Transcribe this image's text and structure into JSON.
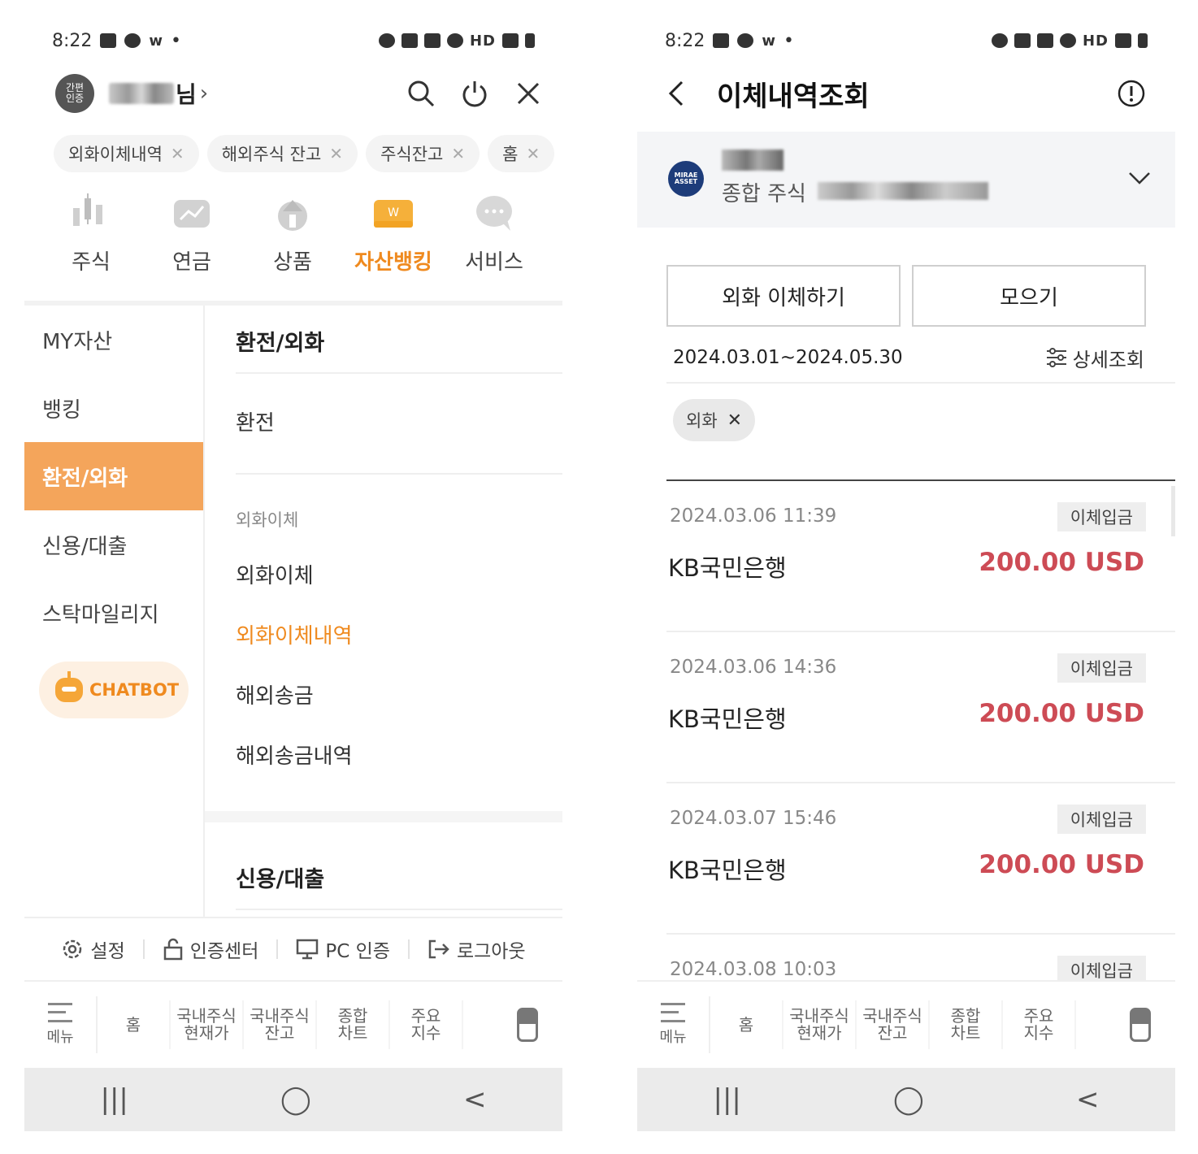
{
  "left": {
    "status": {
      "time": "8:22",
      "icons_left": [
        "gallery-icon",
        "talk-icon",
        "w-icon"
      ],
      "icons_right": [
        "alarm-icon",
        "mute-icon",
        "battery-saver-icon",
        "wifi-icon",
        "hd-voice-icon",
        "signal-icon",
        "battery-icon"
      ]
    },
    "header": {
      "avatar_text": "간편\n인증",
      "name_suffix": "님",
      "chevron": "›"
    },
    "recent_chips": [
      {
        "label": "외화이체내역"
      },
      {
        "label": "해외주식 잔고"
      },
      {
        "label": "주식잔고"
      },
      {
        "label": "홈"
      }
    ],
    "categories": [
      {
        "label": "주식",
        "icon": "stock-candle-icon"
      },
      {
        "label": "연금",
        "icon": "pension-icon"
      },
      {
        "label": "상품",
        "icon": "product-icon"
      },
      {
        "label": "자산뱅킹",
        "icon": "wallet-icon",
        "active": true
      },
      {
        "label": "서비스",
        "icon": "chat-bubble-icon"
      }
    ],
    "side_menu": [
      "MY자산",
      "뱅킹",
      "환전/외화",
      "신용/대출",
      "스탁마일리지"
    ],
    "side_active": "환전/외화",
    "chatbot_label": "CHATBOT",
    "main_menu": {
      "section1_title": "환전/외화",
      "item_exchange": "환전",
      "sub_title": "외화이체",
      "items": [
        "외화이체",
        "외화이체내역",
        "해외송금",
        "해외송금내역"
      ],
      "active_item": "외화이체내역",
      "section2_title": "신용/대출"
    },
    "util": [
      "설정",
      "인증센터",
      "PC 인증",
      "로그아웃"
    ],
    "tabbar": {
      "menu_label": "메뉴",
      "items": [
        "홈",
        "국내주식\n현재가",
        "국내주식\n잔고",
        "종합\n차트",
        "주요\n지수"
      ]
    },
    "navbar": [
      "|||",
      "◯",
      "<"
    ]
  },
  "right": {
    "status": {
      "time": "8:22"
    },
    "header": {
      "title": "이체내역조회"
    },
    "account": {
      "logo_text": "MIRAE\nASSET",
      "type": "종합 주식"
    },
    "buttons": [
      "외화 이체하기",
      "모으기"
    ],
    "date_range": "2024.03.01~2024.05.30",
    "detail_label": "상세조회",
    "filter_chip": "외화",
    "transactions": [
      {
        "date": "2024.03.06 11:39",
        "badge": "이체입금",
        "bank": "KB국민은행",
        "amount": "200.00 USD"
      },
      {
        "date": "2024.03.06 14:36",
        "badge": "이체입금",
        "bank": "KB국민은행",
        "amount": "200.00 USD"
      },
      {
        "date": "2024.03.07 15:46",
        "badge": "이체입금",
        "bank": "KB국민은행",
        "amount": "200.00 USD"
      },
      {
        "date": "2024.03.08 10:03",
        "badge": "이체입금",
        "bank": "",
        "amount": ""
      }
    ],
    "tabbar": {
      "menu_label": "메뉴",
      "items": [
        "홈",
        "국내주식\n현재가",
        "국내주식\n잔고",
        "종합\n차트",
        "주요\n지수"
      ]
    },
    "navbar": [
      "|||",
      "◯",
      "<"
    ]
  },
  "colors": {
    "accent": "#ef8a1f",
    "active_side_bg": "#f4a55b",
    "amount_red": "#cd4b55",
    "brand_blue": "#1d3c7a"
  }
}
